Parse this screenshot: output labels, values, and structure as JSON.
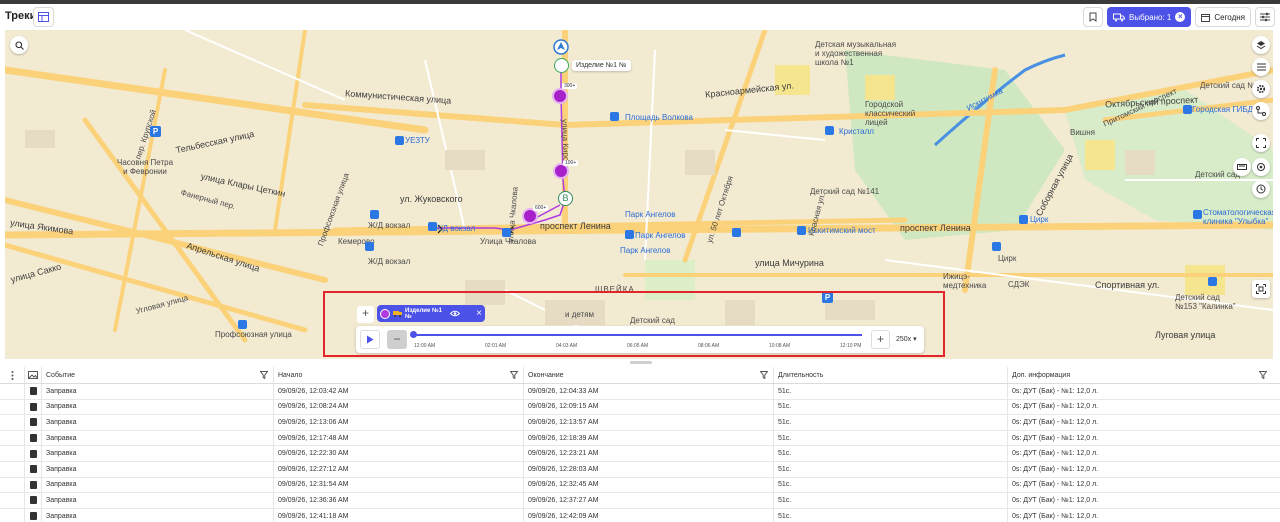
{
  "header": {
    "title": "Треки",
    "selected_label": "Выбрано: 1",
    "today_label": "Сегодня"
  },
  "map": {
    "labels": {
      "kommunisticheskaya": "Коммунистическая улица",
      "krasnoarmeyskaya": "Красноармейская ул.",
      "oktyabrsky": "Октябрьский проспект",
      "pritomsky": "Притомский проспект",
      "lenina_left": "проспект Ленина",
      "lenina_right": "проспект Ленина",
      "michurina": "улица Мичурина",
      "zhukovskogo": "ул. Жуковского",
      "yakimova": "улица Якимова",
      "sakko": "улица Сакко",
      "aprelskaya": "Апрельская улица",
      "klary": "улица Клары Цеткин",
      "fanerny": "Фанерный пер.",
      "telbesskaya": "Тельбесская улица",
      "uglovaya": "Угловая улица",
      "profsoyuznaya_b": "Профсоюзная улица",
      "profsoyuznaya_v": "Профсоюзная улица",
      "chkalova": "улица Чкалова",
      "chkalova_stop": "Улица Чкалова",
      "oktyabrya": "ул. 50 лет Октября",
      "sportivnaya": "Спортивная ул.",
      "lugovaya": "Луговая улица",
      "sovetskaya": "Соборная улица",
      "kirova": "улица Кирова",
      "iskitimka": "Искитимка",
      "krasnaya": "Красная ул.",
      "krupskoi": "пер. Крупской",
      "chasovnya": "Часовня Петра\nи Февронии",
      "kemerovo": "Кемерово",
      "zhd_vokzal": "Ж/Д вокзал",
      "zhd_vokzal2": "Ж/Д вокзал",
      "zhd_vokzal3": "Ж/Д вокзал",
      "uezt": "УЕЗТУ",
      "ploshchad": "Площадь Волкова",
      "kristall": "Кристалл",
      "park1": "Парк Ангелов",
      "park2": "Парк Ангелов",
      "park3": "Парк Ангелов",
      "iskitimsky": "Искитимский мост",
      "tsirk": "Цирк",
      "tsirk2": "Цирк",
      "stomat": "Стоматологическая\nклиника \"Улыбка\"",
      "muzshkola": "Детская музыкальная\nи художественная\nшкола №1",
      "litsey": "Городской\nклассический\nлицей",
      "ds141": "Детский сад №141",
      "ds20": "Детский сад №20",
      "ds": "Детский сад",
      "gibdd": "Городская ГИБДД",
      "vishnya": "Вишня",
      "izhits": "Ижицэ-\nмедтехника",
      "sdek": "СДЭК",
      "ds153": "Детский сад\n№153 \"Калинка\"",
      "shveyka": "ШВЕЙКА",
      "deti": "и детям",
      "detsad": "Детский сад"
    },
    "marker_label": "Изделие №1 №",
    "point_b": "B",
    "flag_labels": [
      "300+",
      "100+",
      "600+"
    ]
  },
  "player": {
    "object_name": "Изделие №1 №",
    "ticks": [
      "12:00 AM",
      "02:01 AM",
      "04:03 AM",
      "06:05 AM",
      "08:06 AM",
      "10:08 AM",
      "12:10 PM"
    ],
    "speed": "250x"
  },
  "table": {
    "columns": [
      "Событие",
      "Начало",
      "Окончание",
      "Длительность",
      "Доп. информация"
    ],
    "rows": [
      [
        "Заправка",
        "09/09/26, 12:03:42 AM",
        "09/09/26, 12:04:33 AM",
        "51с.",
        "0s: ДУТ (Бак) - №1: 12,0 л."
      ],
      [
        "Заправка",
        "09/09/26, 12:08:24 AM",
        "09/09/26, 12:09:15 AM",
        "51с.",
        "0s: ДУТ (Бак) - №1: 12,0 л."
      ],
      [
        "Заправка",
        "09/09/26, 12:13:06 AM",
        "09/09/26, 12:13:57 AM",
        "51с.",
        "0s: ДУТ (Бак) - №1: 12,0 л."
      ],
      [
        "Заправка",
        "09/09/26, 12:17:48 AM",
        "09/09/26, 12:18:39 AM",
        "51с.",
        "0s: ДУТ (Бак) - №1: 12,0 л."
      ],
      [
        "Заправка",
        "09/09/26, 12:22:30 AM",
        "09/09/26, 12:23:21 AM",
        "51с.",
        "0s: ДУТ (Бак) - №1: 12,0 л."
      ],
      [
        "Заправка",
        "09/09/26, 12:27:12 AM",
        "09/09/26, 12:28:03 AM",
        "51с.",
        "0s: ДУТ (Бак) - №1: 12,0 л."
      ],
      [
        "Заправка",
        "09/09/26, 12:31:54 AM",
        "09/09/26, 12:32:45 AM",
        "51с.",
        "0s: ДУТ (Бак) - №1: 12,0 л."
      ],
      [
        "Заправка",
        "09/09/26, 12:36:36 AM",
        "09/09/26, 12:37:27 AM",
        "51с.",
        "0s: ДУТ (Бак) - №1: 12,0 л."
      ],
      [
        "Заправка",
        "09/09/26, 12:41:18 AM",
        "09/09/26, 12:42:09 AM",
        "51с.",
        "0s: ДУТ (Бак) - №1: 12,0 л."
      ]
    ]
  },
  "colors": {
    "accent": "#4c52e8",
    "track": "#b03be0",
    "highlight": "#e0262a",
    "map_bg": "#f3ead2",
    "park": "#cfe8c2",
    "river": "#4a90e2"
  }
}
